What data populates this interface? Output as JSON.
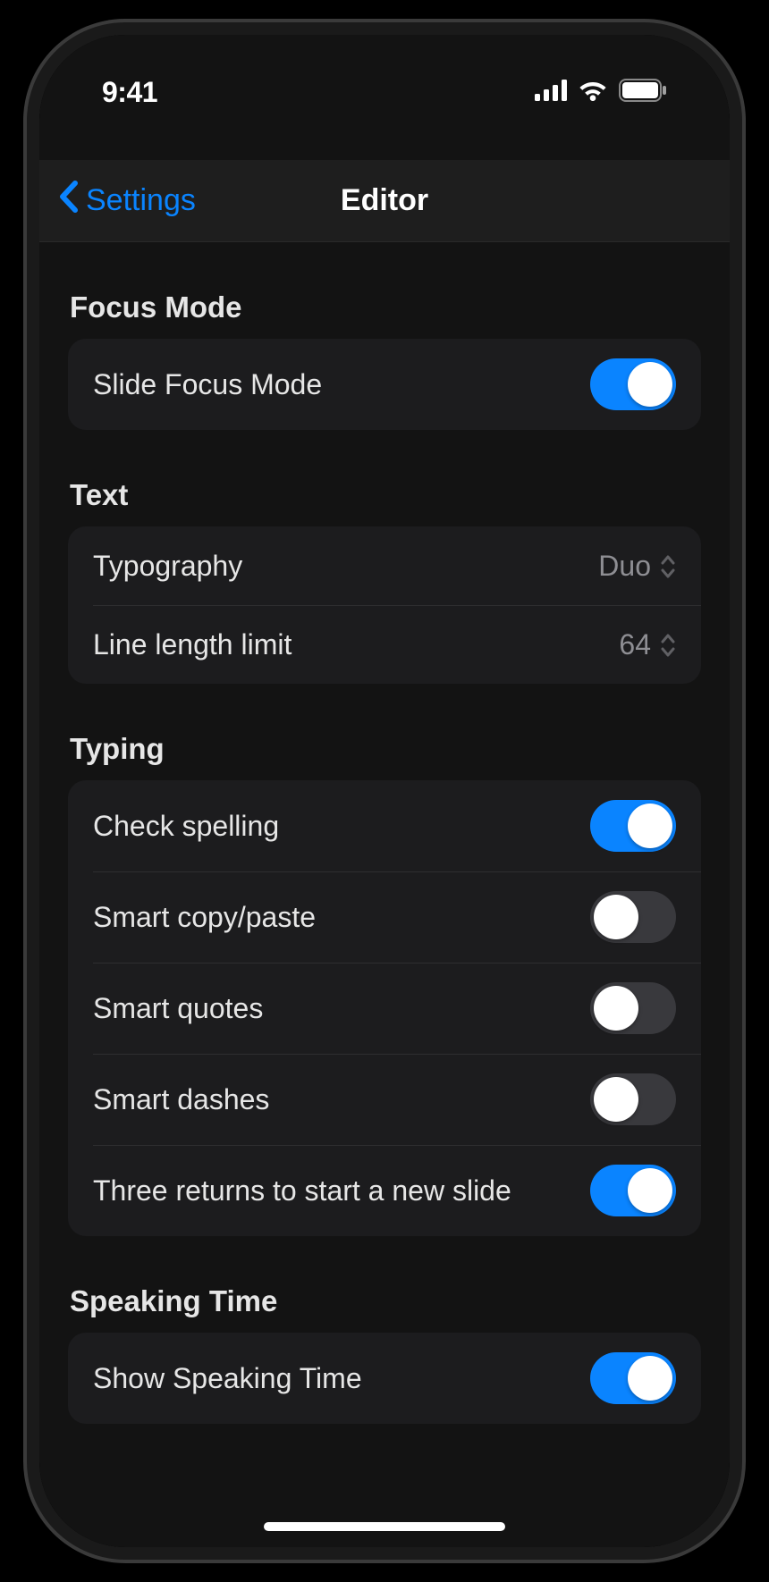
{
  "status": {
    "time": "9:41"
  },
  "nav": {
    "back_label": "Settings",
    "title": "Editor"
  },
  "sections": {
    "focus": {
      "header": "Focus Mode",
      "slide_focus_label": "Slide Focus Mode",
      "slide_focus_on": true
    },
    "text": {
      "header": "Text",
      "typography_label": "Typography",
      "typography_value": "Duo",
      "line_length_label": "Line length limit",
      "line_length_value": "64"
    },
    "typing": {
      "header": "Typing",
      "check_spelling_label": "Check spelling",
      "check_spelling_on": true,
      "smart_copy_label": "Smart copy/paste",
      "smart_copy_on": false,
      "smart_quotes_label": "Smart quotes",
      "smart_quotes_on": false,
      "smart_dashes_label": "Smart dashes",
      "smart_dashes_on": false,
      "three_returns_label": "Three returns to start a new slide",
      "three_returns_on": true
    },
    "speaking": {
      "header": "Speaking Time",
      "show_speaking_label": "Show Speaking Time",
      "show_speaking_on": true
    }
  }
}
